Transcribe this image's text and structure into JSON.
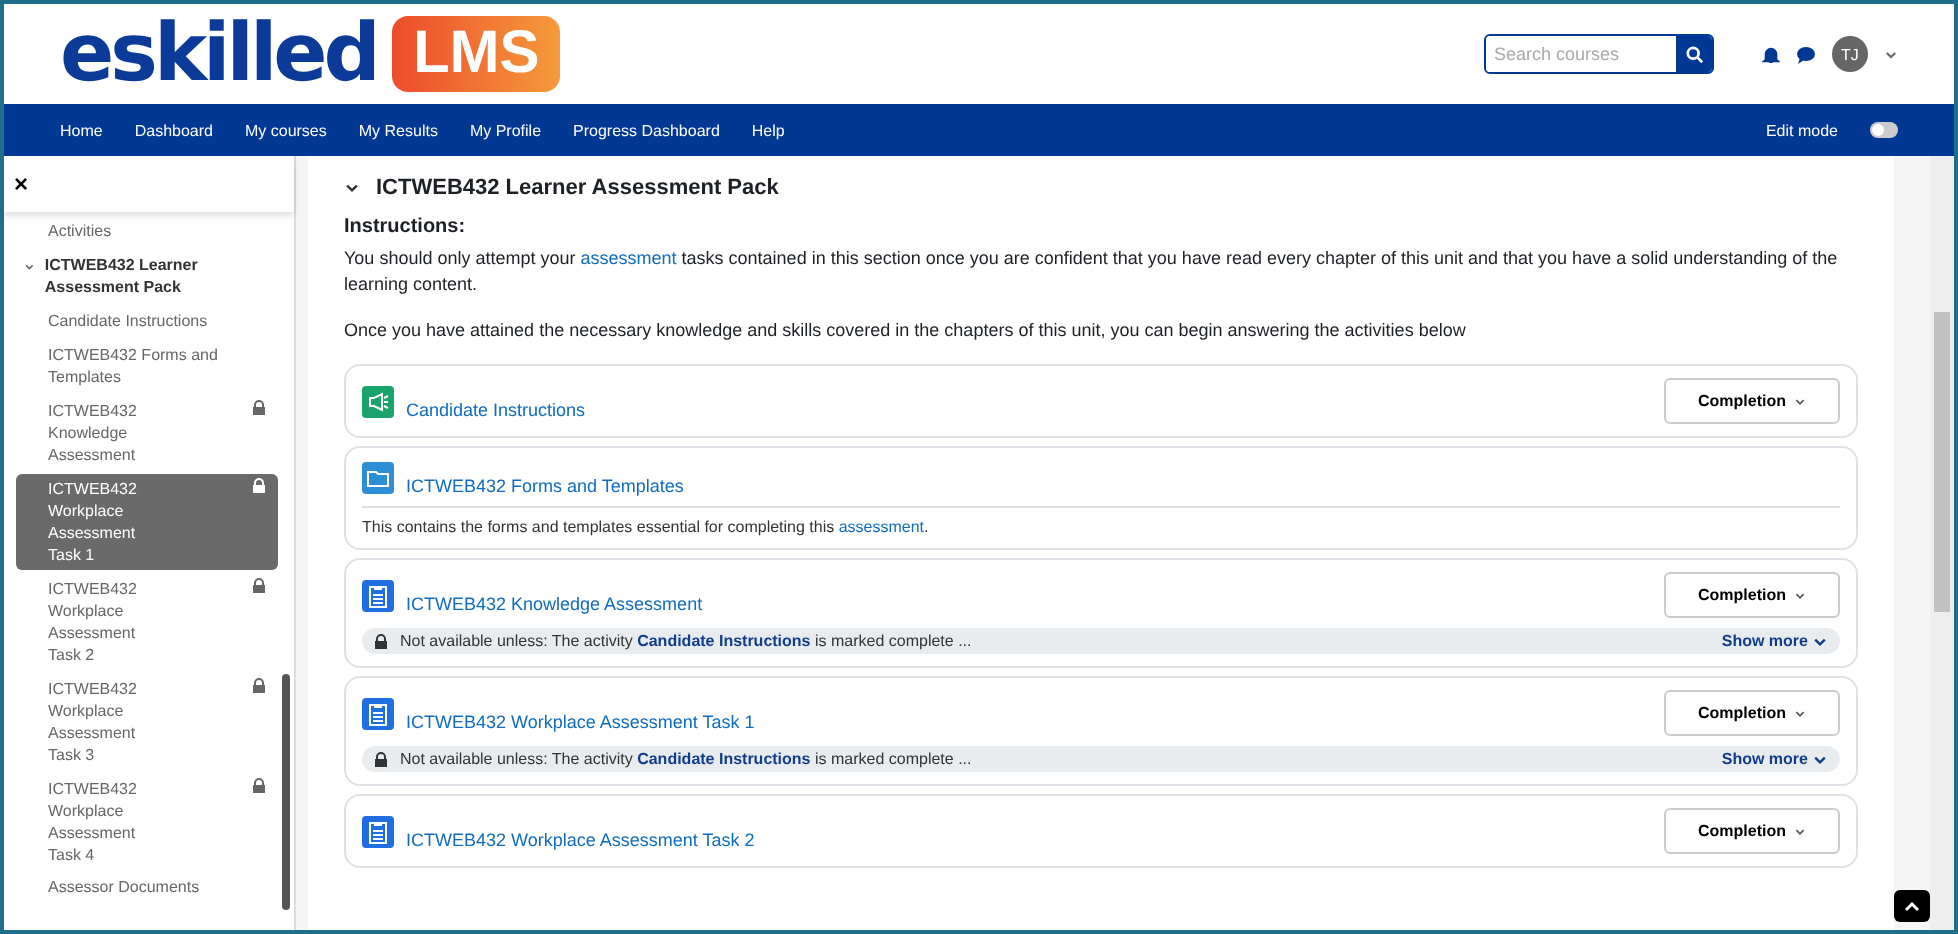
{
  "brand": {
    "logo_text": "eskilled",
    "badge": "LMS"
  },
  "search": {
    "placeholder": "Search courses"
  },
  "user": {
    "initials": "TJ"
  },
  "nav": {
    "items": [
      "Home",
      "Dashboard",
      "My courses",
      "My Results",
      "My Profile",
      "Progress Dashboard",
      "Help"
    ],
    "edit_mode": {
      "label": "Edit mode",
      "on": false
    }
  },
  "sidebar": {
    "close": "×",
    "top_item": "Activities",
    "section": {
      "title": "ICTWEB432 Learner Assessment Pack",
      "expanded": true,
      "items": [
        {
          "label": "Candidate Instructions",
          "locked": false,
          "selected": false
        },
        {
          "label": "ICTWEB432 Forms and Templates",
          "locked": false,
          "selected": false
        },
        {
          "label": "ICTWEB432 Knowledge Assessment",
          "locked": true,
          "selected": false
        },
        {
          "label": "ICTWEB432 Workplace Assessment Task 1",
          "locked": true,
          "selected": true
        },
        {
          "label": "ICTWEB432 Workplace Assessment Task 2",
          "locked": true,
          "selected": false
        },
        {
          "label": "ICTWEB432 Workplace Assessment Task 3",
          "locked": true,
          "selected": false
        },
        {
          "label": "ICTWEB432 Workplace Assessment Task 4",
          "locked": true,
          "selected": false
        }
      ]
    },
    "bottom_item": "Assessor Documents"
  },
  "section": {
    "title": "ICTWEB432 Learner Assessment Pack",
    "expanded": true,
    "instructions_heading": "Instructions:",
    "paragraphs": [
      {
        "before": "You should only attempt your ",
        "link": "assessment",
        "after": " tasks contained in this section once you are confident that you have read every chapter of this unit and that you have a solid understanding of the learning content."
      },
      {
        "before": "Once you have attained the necessary knowledge and skills covered in the chapters of this unit, you can begin answering the activities below"
      }
    ]
  },
  "activities": [
    {
      "kind": "page",
      "title": "Candidate Instructions",
      "completion": "Completion"
    },
    {
      "kind": "folder",
      "title": "ICTWEB432 Forms and Templates",
      "description": {
        "before": "This contains the forms and templates essential for completing this ",
        "link": "assessment",
        "after": "."
      }
    },
    {
      "kind": "assignment",
      "title": "ICTWEB432 Knowledge Assessment",
      "completion": "Completion",
      "restriction": {
        "before": "Not available unless: The activity ",
        "link": "Candidate Instructions",
        "after": " is marked complete ...",
        "toggle": "Show more"
      }
    },
    {
      "kind": "assignment",
      "title": "ICTWEB432 Workplace Assessment Task 1",
      "completion": "Completion",
      "restriction": {
        "before": "Not available unless: The activity ",
        "link": "Candidate Instructions",
        "after": " is marked complete ...",
        "toggle": "Show more"
      }
    },
    {
      "kind": "assignment",
      "title": "ICTWEB432 Workplace Assessment Task 2",
      "completion": "Completion"
    }
  ]
}
